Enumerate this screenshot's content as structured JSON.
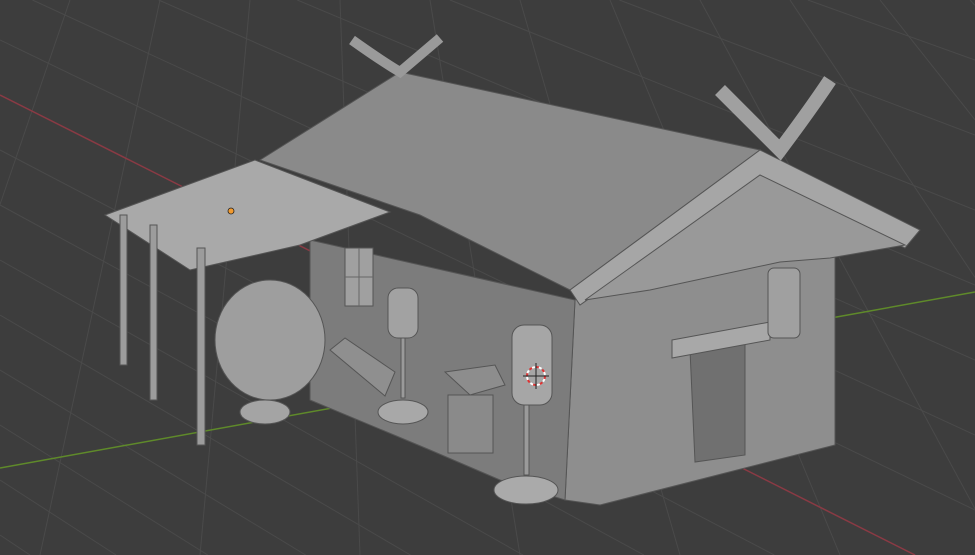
{
  "viewport": {
    "mode": "solid",
    "colors": {
      "background": "#3d3d3d",
      "grid": "#4a4a4a",
      "x_axis": "#8a3a44",
      "y_axis": "#5f8a2a",
      "model": "#9a9a9a",
      "model_light": "#b4b4b4",
      "model_dark": "#6e6e6e",
      "origin": "#f29a2e",
      "cursor": "#d33"
    },
    "icons": [
      "origin-dot-icon",
      "3d-cursor-icon"
    ]
  }
}
